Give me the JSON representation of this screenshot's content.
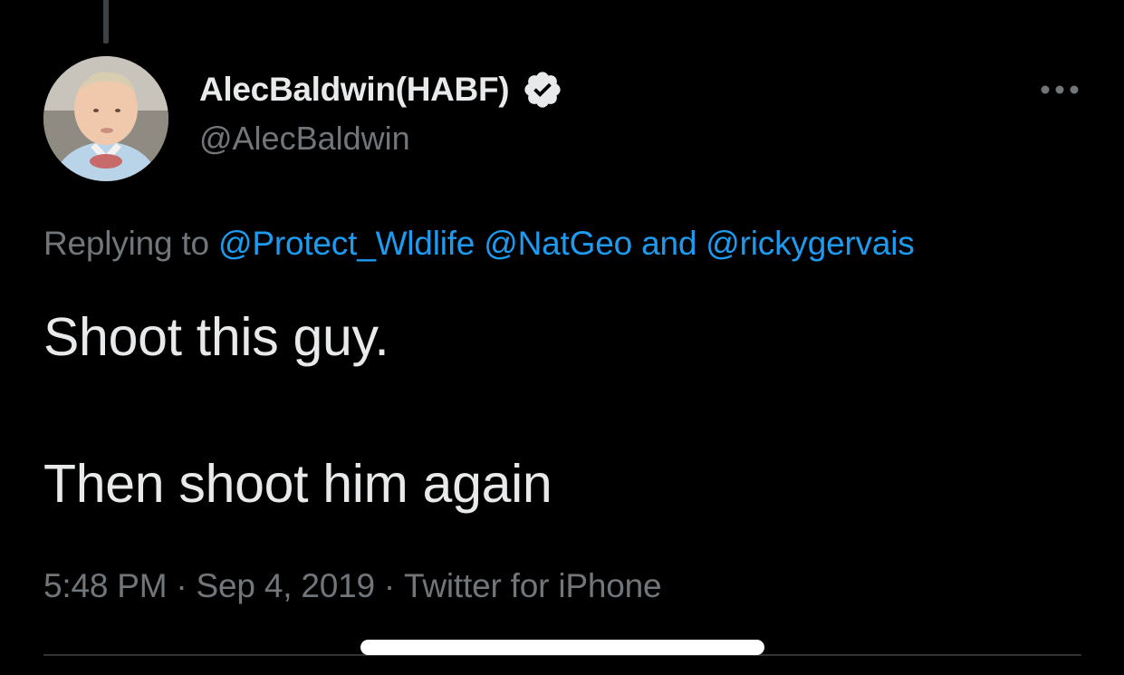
{
  "tweet": {
    "author": {
      "display_name": "AlecBaldwin(HABF)",
      "handle": "@AlecBaldwin",
      "verified": true
    },
    "replying_to": {
      "prefix": "Replying to",
      "mentions": [
        "@Protect_Wldlife",
        "@NatGeo",
        "@rickygervais"
      ],
      "conjunction": "and"
    },
    "text_lines": [
      "Shoot this guy.",
      "Then shoot him again"
    ],
    "meta": {
      "time": "5:48 PM",
      "date": "Sep 4, 2019",
      "source": "Twitter for iPhone",
      "separator": "·"
    }
  },
  "icons": {
    "verified": "verified-badge-icon",
    "more": "more-horizontal-icon"
  },
  "colors": {
    "background": "#000000",
    "primary_text": "#e7e9ea",
    "secondary_text": "#71767b",
    "link": "#1d9bf0",
    "divider": "#2f3336",
    "home_indicator": "#ffffff"
  }
}
